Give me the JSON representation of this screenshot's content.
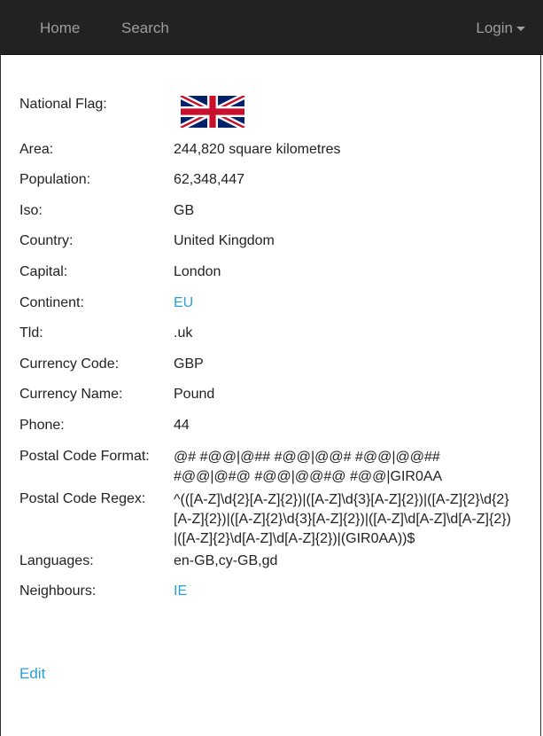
{
  "navbar": {
    "home": "Home",
    "search": "Search",
    "login": "Login"
  },
  "country": {
    "flag_label": "National Flag:",
    "flag_icon": "uk-flag-icon",
    "rows": [
      {
        "label": "Area:",
        "value": "244,820 square kilometres"
      },
      {
        "label": "Population:",
        "value": "62,348,447"
      },
      {
        "label": "Iso:",
        "value": "GB"
      },
      {
        "label": "Country:",
        "value": "United Kingdom"
      },
      {
        "label": "Capital:",
        "value": "London"
      },
      {
        "label": "Continent:",
        "value": "EU"
      },
      {
        "label": "Tld:",
        "value": ".uk"
      },
      {
        "label": "Currency Code:",
        "value": "GBP"
      },
      {
        "label": "Currency Name:",
        "value": "Pound"
      },
      {
        "label": "Phone:",
        "value": "44"
      },
      {
        "label": "Postal Code Format:",
        "value": "@# #@@|@## #@@|@@# #@@|@@## #@@|@#@ #@@|@@#@ #@@|GIR0AA"
      },
      {
        "label": "Postal Code Regex:",
        "value": "^(([A-Z]\\d{2}[A-Z]{2})|([A-Z]\\d{3}[A-Z]{2})|([A-Z]{2}\\d{2}[A-Z]{2})|([A-Z]{2}\\d{3}[A-Z]{2})|([A-Z]\\d[A-Z]\\d[A-Z]{2})|([A-Z]{2}\\d[A-Z]\\d[A-Z]{2})|(GIR0AA))$"
      },
      {
        "label": "Languages:",
        "value": "en-GB,cy-GB,gd"
      },
      {
        "label": "Neighbours:",
        "value": "IE"
      }
    ]
  },
  "actions": {
    "edit": "Edit"
  },
  "colors": {
    "navbar_bg": "#222222",
    "nav_text": "#9d9d9d",
    "link": "#2a9fd6"
  }
}
